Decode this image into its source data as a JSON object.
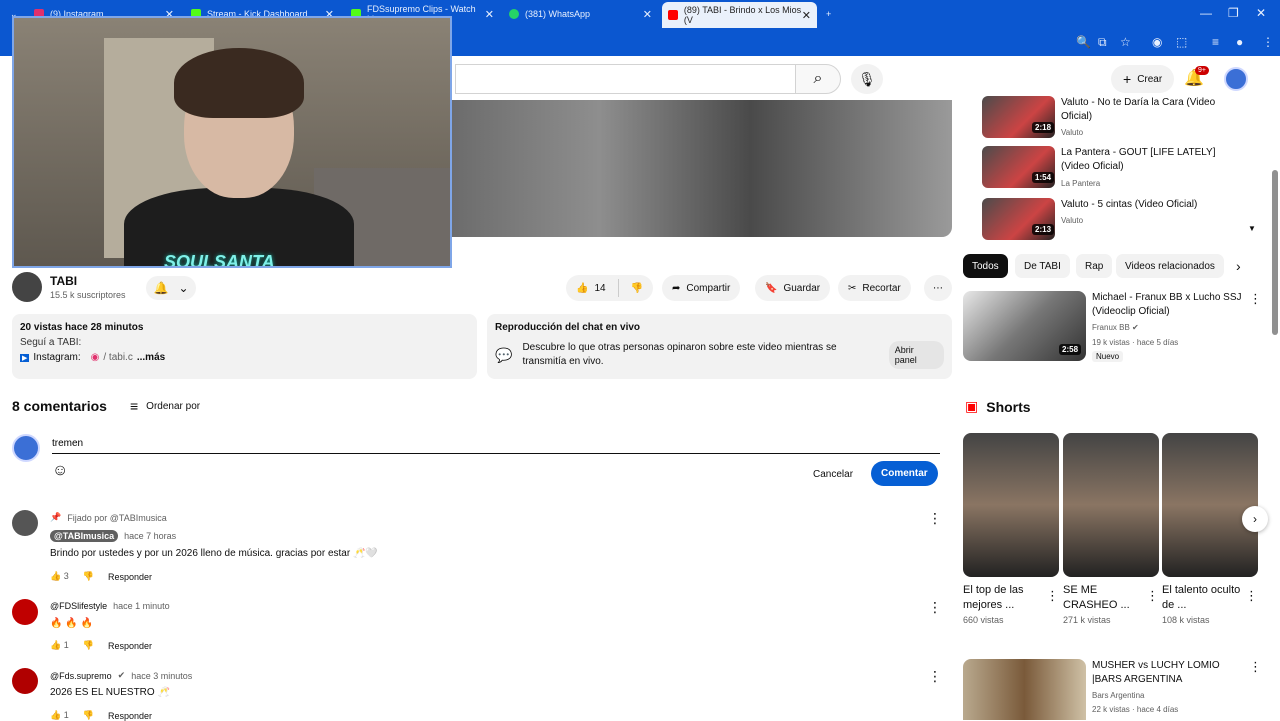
{
  "browser": {
    "tabs": [
      {
        "label": "(9) Instagram",
        "color": "#e1306c"
      },
      {
        "label": "Stream - Kick Dashboard",
        "color": "#53fc18"
      },
      {
        "label": "FDSsupremo Clips - Watch Live",
        "color": "#53fc18"
      },
      {
        "label": "(381) WhatsApp",
        "color": "#25d366"
      },
      {
        "label": "(89) TABI - Brindo x Los Mios (V",
        "color": "#ff0000"
      }
    ],
    "new_tab": "+"
  },
  "header": {
    "create_label": "Crear",
    "notif_badge": "9+"
  },
  "webcam": {
    "overlay_text": "SOULSANTA"
  },
  "channel": {
    "name": "TABI",
    "subs": "15.5 k suscriptores"
  },
  "actions": {
    "likes": "14",
    "share": "Compartir",
    "save": "Guardar",
    "clip": "Recortar"
  },
  "description": {
    "stats": "20 vistas  hace 28 minutos",
    "line1": "Seguí a TABI:",
    "line2_prefix": "Instagram:",
    "line2_link": "/ tabi.c",
    "more": "...más"
  },
  "chat": {
    "title": "Reproducción del chat en vivo",
    "body": "Descubre lo que otras personas opinaron sobre este video mientras se transmitía en vivo.",
    "button": "Abrir panel"
  },
  "comments": {
    "count": "8 comentarios",
    "sort": "Ordenar por",
    "input_value": "tremen",
    "cancel": "Cancelar",
    "submit": "Comentar",
    "reply": "Responder",
    "items": [
      {
        "pinned": "Fijado por @TABImusica",
        "author": "@TABImusica",
        "time": "hace 7 horas",
        "text": "Brindo por ustedes y por un 2026 lleno de música. gracias por estar 🥂🤍",
        "likes": "3"
      },
      {
        "author": "@FDSlifestyle",
        "time": "hace 1 minuto",
        "text": "🔥 🔥 🔥",
        "likes": "1"
      },
      {
        "author": "@Fds.supremo",
        "time": "hace 3 minutos",
        "text": "2026 ES EL NUESTRO 🥂",
        "likes": "1"
      }
    ]
  },
  "related_top": [
    {
      "title": "Valuto - No te Daría la Cara (Video Oficial)",
      "channel": "Valuto",
      "duration": "2:18"
    },
    {
      "title": "La Pantera - GOUT [LIFE LATELY] (Video Oficial)",
      "channel": "La Pantera",
      "duration": "1:54"
    },
    {
      "title": "Valuto - 5 cintas (Video Oficial)",
      "channel": "Valuto",
      "duration": "2:13"
    }
  ],
  "filters": [
    "Todos",
    "De TABI",
    "Rap",
    "Videos relacionados"
  ],
  "featured": {
    "title": "Michael  - Franux BB x Lucho SSJ (Videoclip Oficial)",
    "channel": "Franux BB",
    "views": "19 k vistas · hace 5 días",
    "badge": "Nuevo",
    "duration": "2:58"
  },
  "shorts": {
    "heading": "Shorts",
    "items": [
      {
        "title": "El top de las mejores ...",
        "views": "660 vistas"
      },
      {
        "title": "SE ME CRASHEO ...",
        "views": "271 k vistas"
      },
      {
        "title": "El talento oculto de ...",
        "views": "108 k vistas"
      }
    ]
  },
  "musher": {
    "title": "MUSHER vs LUCHY LOMIO |BARS ARGENTINA",
    "channel": "Bars Argentina",
    "views": "22 k vistas · hace 4 días"
  }
}
